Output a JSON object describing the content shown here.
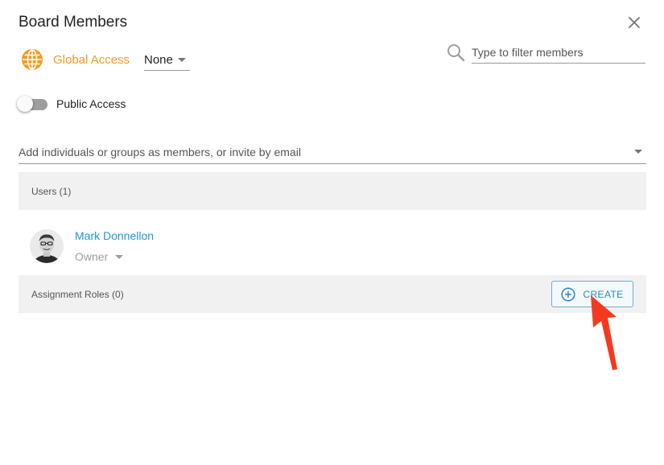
{
  "dialog": {
    "title": "Board Members"
  },
  "global_access": {
    "label": "Global Access",
    "value": "None"
  },
  "filter": {
    "placeholder": "Type to filter members"
  },
  "public_access": {
    "label": "Public Access",
    "enabled": false
  },
  "add_member": {
    "placeholder": "Add individuals or groups as members, or invite by email"
  },
  "users": {
    "header": "Users (1)",
    "items": [
      {
        "name": "Mark Donnellon",
        "role": "Owner"
      }
    ]
  },
  "roles": {
    "header": "Assignment Roles (0)",
    "create_label": "CREATE"
  },
  "colors": {
    "accent": "#2196d3",
    "global_access": "#f29a1f",
    "annotation_arrow": "#f5391f"
  },
  "icons": [
    "close-icon",
    "globe-icon",
    "search-icon",
    "dropdown-caret-icon",
    "add-circle-icon"
  ]
}
